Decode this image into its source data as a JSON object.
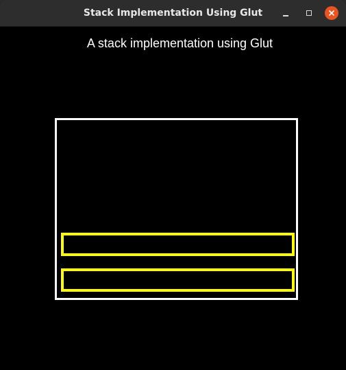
{
  "window": {
    "title": "Stack Implementation Using Glut",
    "controls": {
      "minimize_icon": "minimize-icon",
      "maximize_icon": "maximize-icon",
      "close_icon": "close-icon"
    },
    "close_color": "#e95420"
  },
  "canvas": {
    "heading": "A stack implementation using Glut",
    "background": "#000000",
    "container_color": "#ffffff",
    "item_color": "#ffff00",
    "stack_items": [
      {
        "position": "second-from-bottom"
      },
      {
        "position": "bottom"
      }
    ]
  }
}
